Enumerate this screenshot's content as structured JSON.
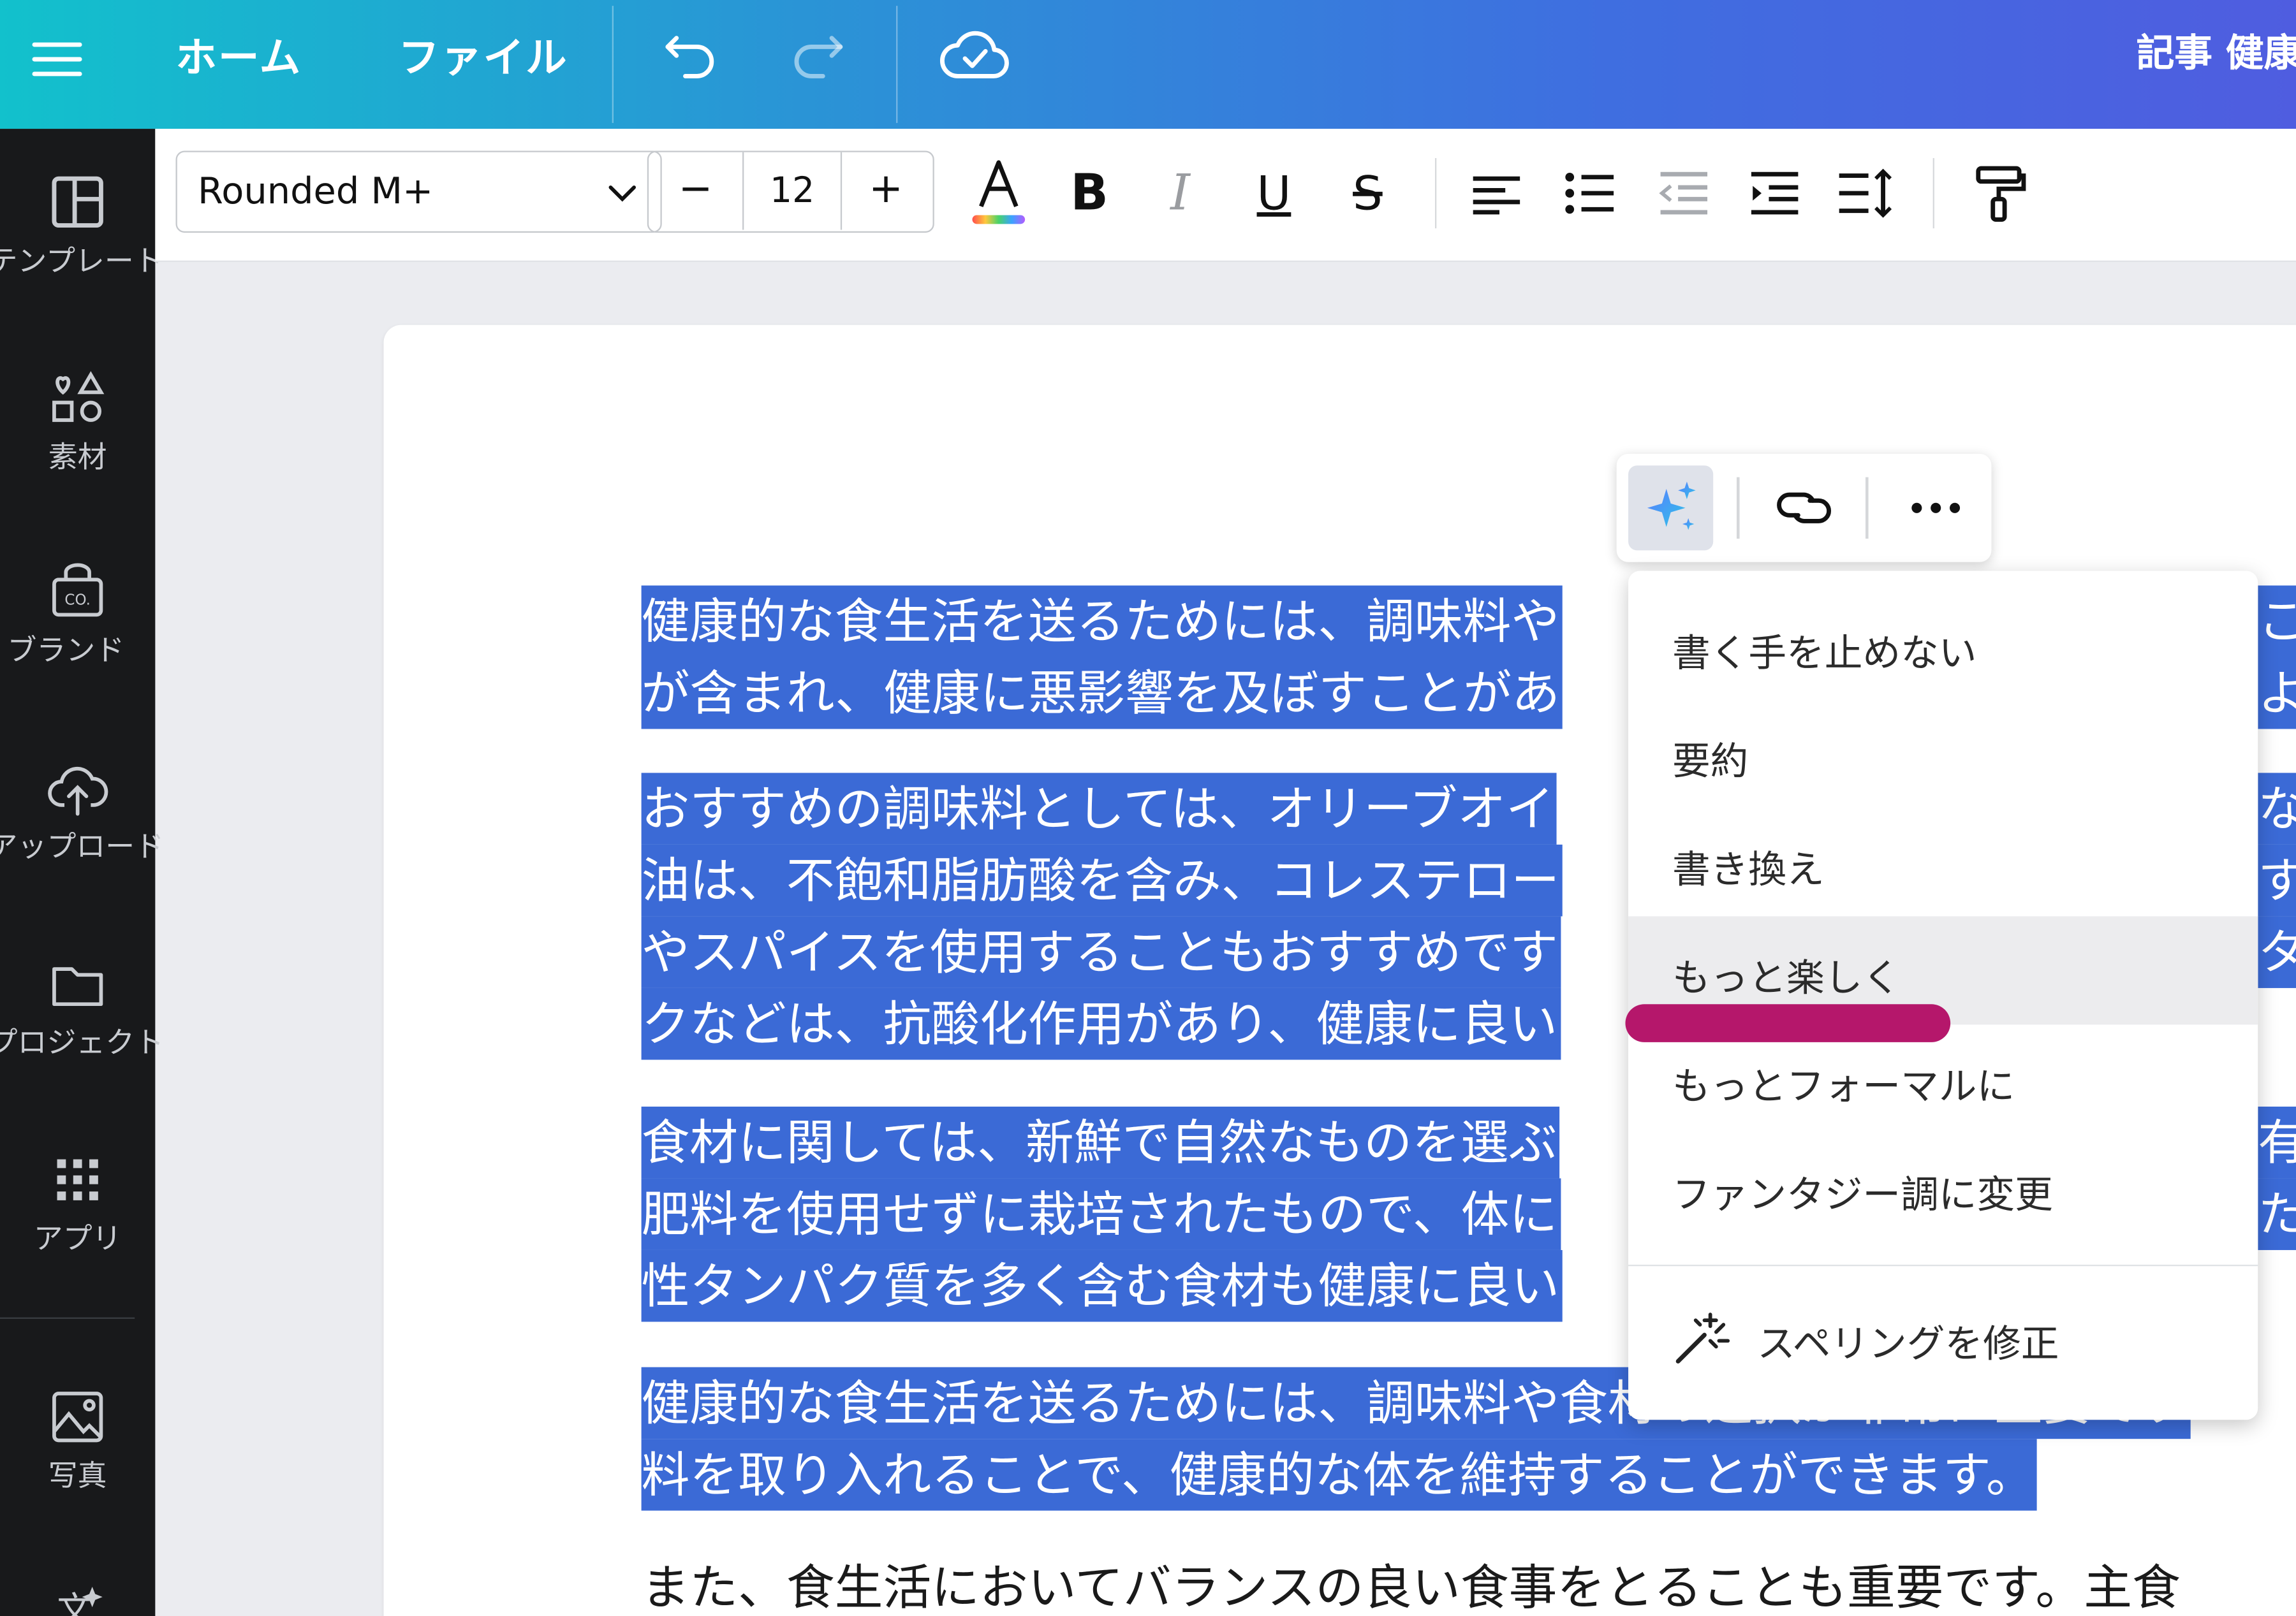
{
  "topbar": {
    "home": "ホーム",
    "file": "ファイル",
    "doc_title": "記事 健康お"
  },
  "sidebar": {
    "items": [
      {
        "label": "テンプレート",
        "icon": "template-icon"
      },
      {
        "label": "素材",
        "icon": "elements-icon"
      },
      {
        "label": "ブランド",
        "icon": "brand-icon"
      },
      {
        "label": "アップロード",
        "icon": "upload-icon"
      },
      {
        "label": "プロジェクト",
        "icon": "folder-icon"
      },
      {
        "label": "アプリ",
        "icon": "apps-icon"
      },
      {
        "label": "写真",
        "icon": "photo-icon"
      }
    ]
  },
  "toolbar": {
    "font_name": "Rounded M+",
    "font_size": "12",
    "minus": "−",
    "plus": "+",
    "color_letter": "A",
    "bold": "B",
    "italic": "I",
    "underline": "U",
    "strike": "S"
  },
  "document": {
    "p1": [
      "健康的な食生活を送るためには、調味料や",
      "が含まれ、健康に悪影響を及ぼすことがあ"
    ],
    "p1r": [
      "こ",
      "よ"
    ],
    "p2": [
      "おすすめの調味料としては、オリーブオイ",
      "油は、不飽和脂肪酸を含み、コレステロー",
      "やスパイスを使用することもおすすめです",
      "クなどは、抗酸化作用があり、健康に良い"
    ],
    "p2r": [
      "な",
      "す",
      "タ",
      ""
    ],
    "p3": [
      "食材に関しては、新鮮で自然なものを選ぶ",
      "肥料を使用せずに栽培されたもので、体に",
      "性タンパク質を多く含む食材も健康に良い"
    ],
    "p3r": [
      "有",
      "た",
      ""
    ],
    "p4": [
      "健康的な食生活を送るためには、調味料や食材の選択が非常に重要です",
      "料を取り入れることで、健康的な体を維持することができます。"
    ],
    "p5": "また、食生活においてバランスの良い食事をとることも重要です。主食"
  },
  "mini_toolbar": {
    "icons": [
      "magic-sparkle-icon",
      "link-icon",
      "more-icon"
    ]
  },
  "menu": {
    "items": [
      "書く手を止めない",
      "要約",
      "書き換え",
      "もっと楽しく",
      "もっとフォーマルに",
      "ファンタジー調に変更"
    ],
    "spell": "スペリングを修正"
  },
  "colors": {
    "selection": "#3b6ad6",
    "annotation": "#b5176b"
  }
}
